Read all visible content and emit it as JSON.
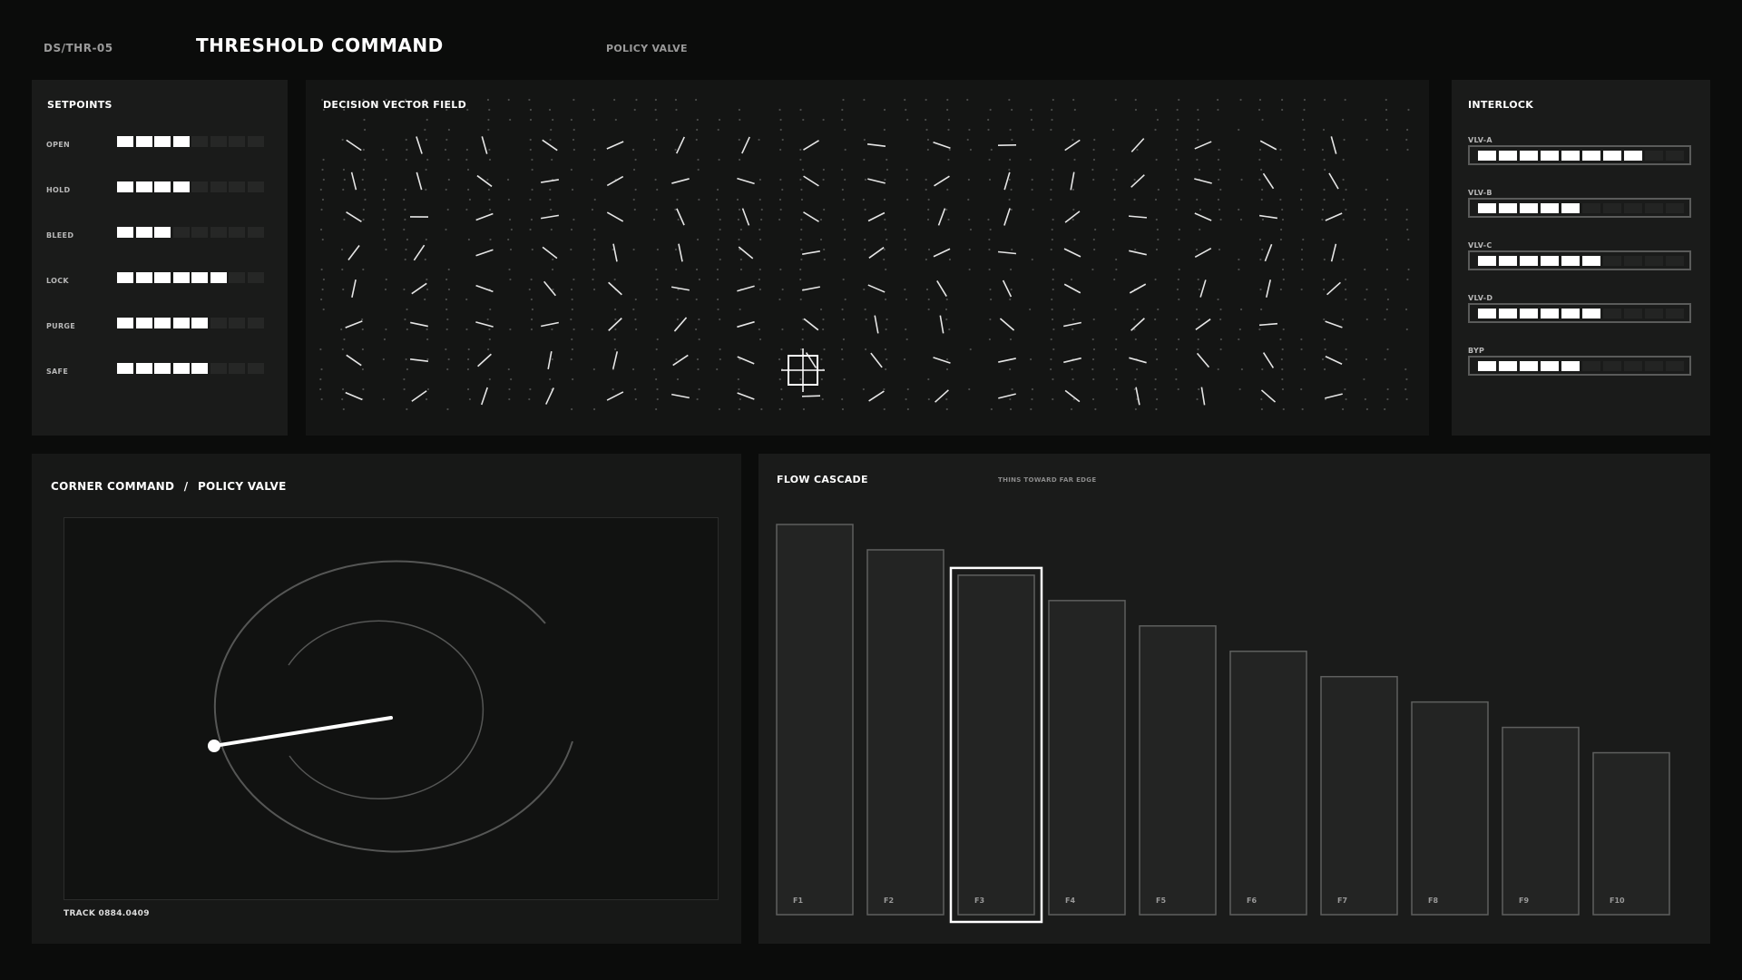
{
  "header": {
    "code": "DS/THR-05",
    "title": "THRESHOLD COMMAND",
    "subtitle": "POLICY VALVE"
  },
  "setpoints": {
    "title": "SETPOINTS",
    "total_segments": 8,
    "items": [
      {
        "label": "OPEN",
        "filled": 4
      },
      {
        "label": "HOLD",
        "filled": 4
      },
      {
        "label": "BLEED",
        "filled": 3
      },
      {
        "label": "LOCK",
        "filled": 6
      },
      {
        "label": "PURGE",
        "filled": 5
      },
      {
        "label": "SAFE",
        "filled": 5
      }
    ]
  },
  "vector_field": {
    "title": "DECISION VECTOR FIELD",
    "cursor_icon": "crosshair-icon"
  },
  "interlock": {
    "title": "INTERLOCK",
    "total_segments": 10,
    "items": [
      {
        "label": "VLV-A",
        "filled": 8
      },
      {
        "label": "VLV-B",
        "filled": 5
      },
      {
        "label": "VLV-C",
        "filled": 6
      },
      {
        "label": "VLV-D",
        "filled": 6
      },
      {
        "label": "BYP",
        "filled": 5
      }
    ]
  },
  "corner": {
    "title": "CORNER COMMAND",
    "separator": "/",
    "subtitle": "POLICY VALVE",
    "track_readout": "TRACK 0884.0409"
  },
  "flow": {
    "title": "FLOW CASCADE",
    "note": "THINS TOWARD FAR EDGE",
    "selected_index": 2
  },
  "chart_data": {
    "type": "bar",
    "categories": [
      "F1",
      "F2",
      "F3",
      "F4",
      "F5",
      "F6",
      "F7",
      "F8",
      "F9",
      "F10"
    ],
    "values": [
      100,
      93.5,
      87,
      80.5,
      74,
      67.5,
      61,
      54.5,
      48,
      41.5
    ],
    "ylim": [
      0,
      100
    ]
  },
  "colors": {
    "bg": "#0b0c0b",
    "panel": "#1a1b1a",
    "accent": "#ffffff",
    "dim": "#2a2b2a"
  }
}
